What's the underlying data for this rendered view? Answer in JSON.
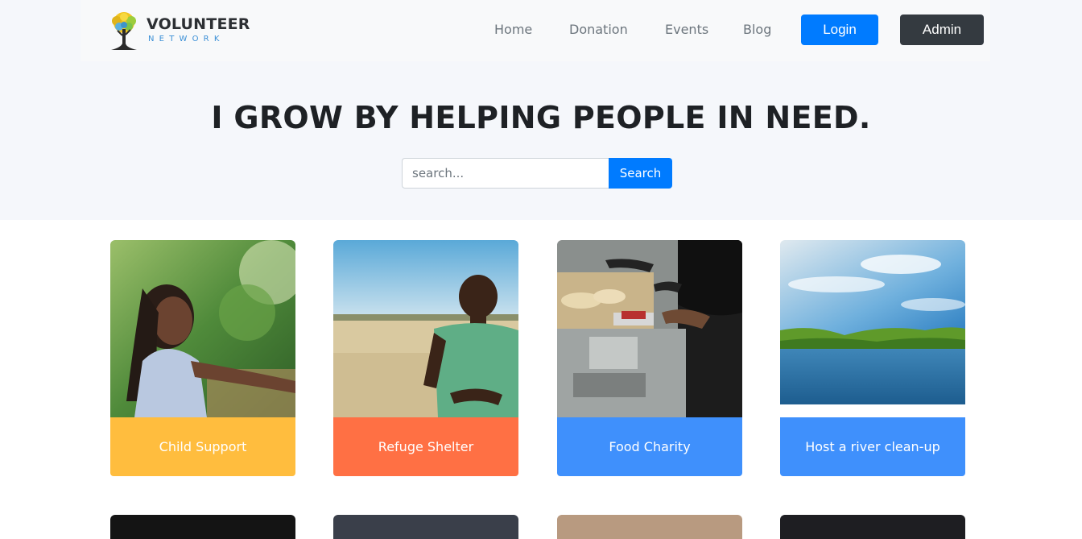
{
  "brand": {
    "name_line1": "VOLUNTEER",
    "name_line2": "NETWORK",
    "icon": "tree-logo-icon"
  },
  "nav": {
    "links": [
      "Home",
      "Donation",
      "Events",
      "Blog"
    ],
    "login_label": "Login",
    "admin_label": "Admin"
  },
  "hero": {
    "headline": "I GROW BY HELPING PEOPLE IN NEED.",
    "search_placeholder": "search...",
    "search_button": "Search"
  },
  "events": [
    {
      "title": "Child Support",
      "color": "#ffbd3e",
      "image": "girl-smiling-photo"
    },
    {
      "title": "Refuge Shelter",
      "color": "#ff7044",
      "image": "boy-in-field-photo"
    },
    {
      "title": "Food Charity",
      "color": "#3f90fc",
      "image": "food-donation-photo"
    },
    {
      "title": "Host a river clean-up",
      "color": "#3f90fc",
      "image": "river-landscape-photo"
    }
  ],
  "colors": {
    "primary": "#007bff",
    "dark": "#343a40",
    "hero_bg": "#f5f7fb"
  }
}
